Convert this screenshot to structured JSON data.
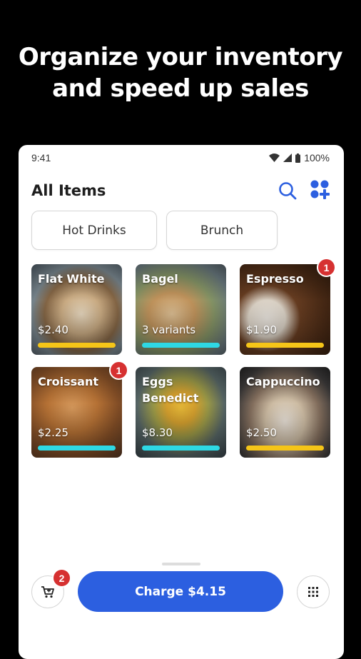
{
  "headline": {
    "line1": "Organize your inventory",
    "line2": "and speed up sales"
  },
  "status_bar": {
    "time": "9:41",
    "battery": "100%",
    "icons": [
      "wifi-icon",
      "signal-icon",
      "battery-icon"
    ]
  },
  "header": {
    "title": "All Items",
    "icons": [
      "search-icon",
      "add-grid-icon"
    ]
  },
  "categories": [
    "Hot Drinks",
    "Brunch"
  ],
  "items": [
    {
      "name": "Flat White",
      "price": "$2.40",
      "bar_color": "#f5c518",
      "badge": null
    },
    {
      "name": "Bagel",
      "price": "3 variants",
      "bar_color": "#2ed8e4",
      "badge": null
    },
    {
      "name": "Espresso",
      "price": "$1.90",
      "bar_color": "#f5c518",
      "badge": "1"
    },
    {
      "name": "Croissant",
      "price": "$2.25",
      "bar_color": "#2ed8e4",
      "badge": "1"
    },
    {
      "name": "Eggs Benedict",
      "price": "$8.30",
      "bar_color": "#2ed8e4",
      "badge": null
    },
    {
      "name": "Cappuccino",
      "price": "$2.50",
      "bar_color": "#f5c518",
      "badge": null
    }
  ],
  "cart": {
    "count": "2",
    "icon": "cart-icon"
  },
  "charge_button": {
    "label": "Charge $4.15"
  },
  "keypad": {
    "icon": "keypad-icon"
  },
  "colors": {
    "accent": "#2c5fe0",
    "badge": "#d63131",
    "bar_yellow": "#f5c518",
    "bar_cyan": "#2ed8e4"
  }
}
